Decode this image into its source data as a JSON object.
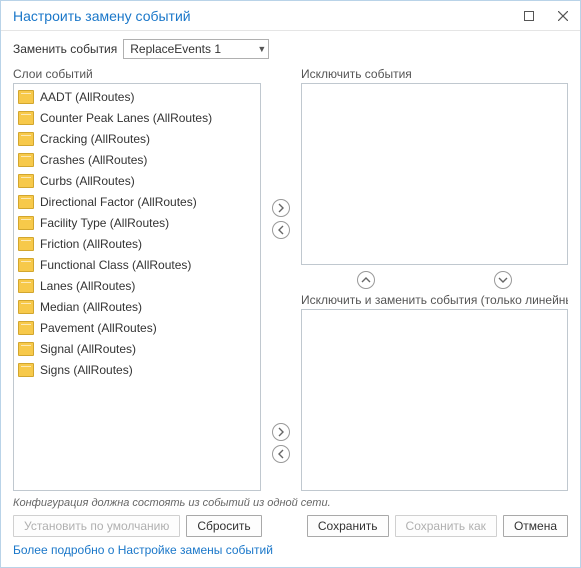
{
  "title": "Настроить замену событий",
  "replace_label": "Заменить события",
  "replace_value": "ReplaceEvents 1",
  "panels": {
    "layers_label": "Слои событий",
    "exclude_label": "Исключить события",
    "exclude_replace_label": "Исключить и заменить события (только линейные события)"
  },
  "layers": [
    "AADT (AllRoutes)",
    "Counter Peak Lanes (AllRoutes)",
    "Cracking (AllRoutes)",
    "Crashes (AllRoutes)",
    "Curbs (AllRoutes)",
    "Directional Factor (AllRoutes)",
    "Facility Type (AllRoutes)",
    "Friction (AllRoutes)",
    "Functional Class (AllRoutes)",
    "Lanes (AllRoutes)",
    "Median (AllRoutes)",
    "Pavement (AllRoutes)",
    "Signal (AllRoutes)",
    "Signs (AllRoutes)"
  ],
  "note": "Конфигурация должна состоять из событий из одной сети.",
  "buttons": {
    "set_default": "Установить по умолчанию",
    "reset": "Сбросить",
    "save": "Сохранить",
    "save_as": "Сохранить как",
    "cancel": "Отмена"
  },
  "footer_link": "Более подробно о Настройке замены событий"
}
